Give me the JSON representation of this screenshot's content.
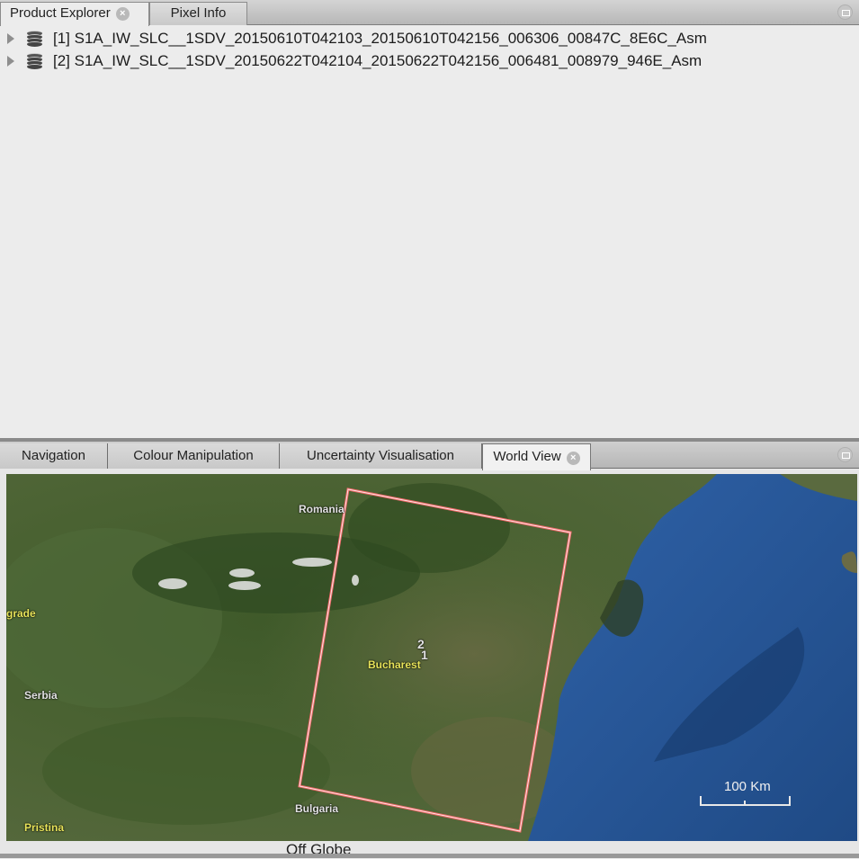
{
  "top_panel": {
    "tabs": [
      {
        "label": "Product Explorer",
        "active": true,
        "closable": true
      },
      {
        "label": "Pixel Info",
        "active": false,
        "closable": false
      }
    ],
    "products": [
      {
        "index": "[1]",
        "name": "S1A_IW_SLC__1SDV_20150610T042103_20150610T042156_006306_00847C_8E6C_Asm",
        "icon": "database-icon",
        "expand_icon": "triangle-right-icon"
      },
      {
        "index": "[2]",
        "name": "S1A_IW_SLC__1SDV_20150622T042104_20150622T042156_006481_008979_946E_Asm",
        "icon": "database-icon",
        "expand_icon": "triangle-right-icon"
      }
    ]
  },
  "bottom_panel": {
    "tabs": [
      {
        "label": "Navigation",
        "active": false
      },
      {
        "label": "Colour Manipulation",
        "active": false
      },
      {
        "label": "Uncertainty Visualisation",
        "active": false
      },
      {
        "label": "World View",
        "active": true,
        "closable": true
      }
    ],
    "map": {
      "labels": {
        "romania": "Romania",
        "belgrade": "grade",
        "serbia": "Serbia",
        "bucharest": "Bucharest",
        "bulgaria": "Bulgaria",
        "pristina": "Pristina"
      },
      "footprint_markers": [
        "2",
        "1"
      ],
      "footprint_color": "#f06a6a",
      "scale_label": "100 Km"
    },
    "status_text": "Off Globe"
  }
}
